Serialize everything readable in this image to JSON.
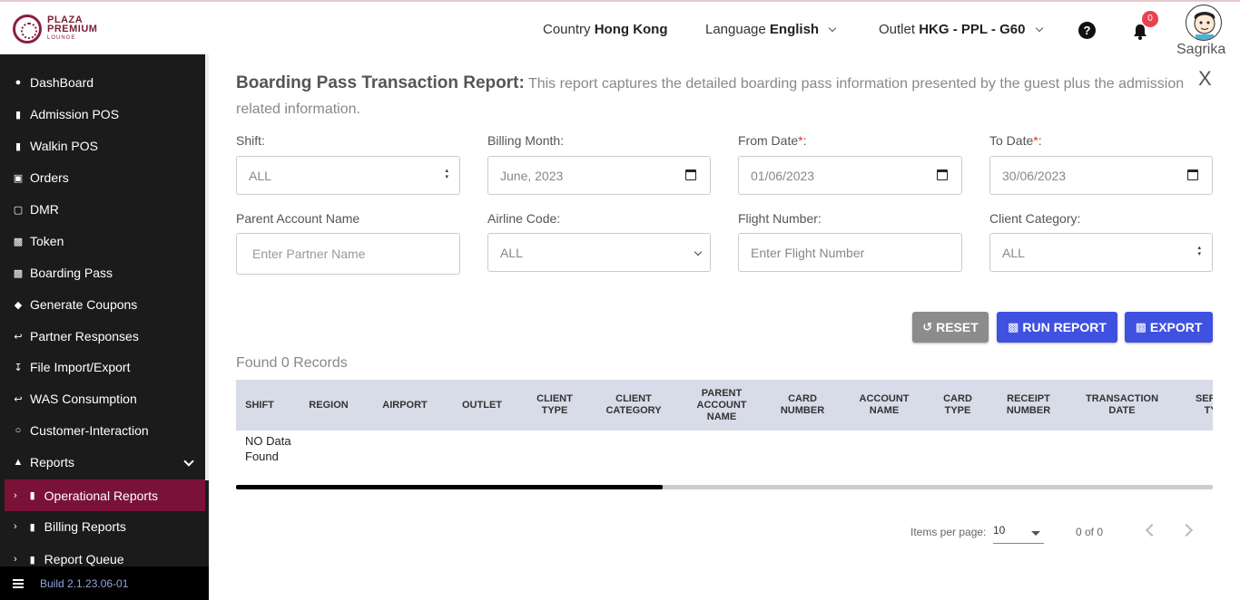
{
  "brand": {
    "line1": "PLAZA",
    "line2": "PREMIUM",
    "line3": "LOUNGE"
  },
  "header": {
    "country_label": "Country",
    "country_value": "Hong Kong",
    "language_label": "Language",
    "language_value": "English",
    "outlet_label": "Outlet",
    "outlet_value": "HKG - PPL - G60",
    "help_icon": "?",
    "notification_count": "0",
    "user_name": "Sagrika"
  },
  "sidebar": {
    "items": [
      {
        "label": "DashBoard",
        "icon": "dashboard-icon"
      },
      {
        "label": "Admission POS",
        "icon": "id-card-icon"
      },
      {
        "label": "Walkin POS",
        "icon": "id-card-icon"
      },
      {
        "label": "Orders",
        "icon": "cart-icon"
      },
      {
        "label": "DMR",
        "icon": "calendar-icon"
      },
      {
        "label": "Token",
        "icon": "document-icon"
      },
      {
        "label": "Boarding Pass",
        "icon": "document-icon"
      },
      {
        "label": "Generate Coupons",
        "icon": "tag-icon"
      },
      {
        "label": "Partner Responses",
        "icon": "reply-icon"
      },
      {
        "label": "File Import/Export",
        "icon": "download-icon"
      },
      {
        "label": "WAS Consumption",
        "icon": "reply-icon"
      },
      {
        "label": "Customer-Interaction",
        "icon": "chat-icon"
      },
      {
        "label": "Reports",
        "icon": "sitemap-icon"
      }
    ],
    "sub_items": [
      {
        "label": "Operational Reports",
        "icon": "book-icon"
      },
      {
        "label": "Billing Reports",
        "icon": "book-icon"
      },
      {
        "label": "Report Queue",
        "icon": "book-icon"
      }
    ],
    "build": "Build 2.1.23.06-01"
  },
  "report": {
    "title": "Boarding Pass Transaction Report:",
    "description": "This report captures the detailed boarding pass information presented by the guest plus the admission related information.",
    "close_label": "X"
  },
  "filters": {
    "shift_label": "Shift:",
    "shift_value": "ALL",
    "billing_month_label": "Billing Month:",
    "billing_month_value": "June, 2023",
    "from_date_label": "From Date",
    "from_date_value": "01/06/2023",
    "to_date_label": "To Date",
    "to_date_value": "30/06/2023",
    "required_mark": "*",
    "colon": ":",
    "parent_account_label": "Parent Account Name",
    "parent_account_placeholder": "Enter Partner Name",
    "airline_code_label": "Airline Code:",
    "airline_code_value": "ALL",
    "flight_number_label": "Flight Number:",
    "flight_number_placeholder": "Enter Flight Number",
    "client_category_label": "Client Category:",
    "client_category_value": "ALL"
  },
  "actions": {
    "reset_label": "RESET",
    "run_label": "RUN REPORT",
    "export_label": "EXPORT"
  },
  "results": {
    "records_text": "Found 0 Records",
    "columns": [
      "SHIFT",
      "REGION",
      "AIRPORT",
      "OUTLET",
      "CLIENT TYPE",
      "CLIENT CATEGORY",
      "PARENT ACCOUNT NAME",
      "CARD NUMBER",
      "ACCOUNT NAME",
      "CARD TYPE",
      "RECEIPT NUMBER",
      "TRANSACTION DATE",
      "SERVICE TYPE"
    ],
    "no_data_text": "NO Data Found"
  },
  "pagination": {
    "items_per_page_label": "Items per page:",
    "items_per_page_value": "10",
    "range_text": "0 of 0"
  },
  "colors": {
    "sidebar_bg": "#1b1b1b",
    "active_item": "#7a1238",
    "reset_button": "#8c8c8c",
    "primary_button": "#3f51e0",
    "table_header": "#d8dbe8"
  }
}
